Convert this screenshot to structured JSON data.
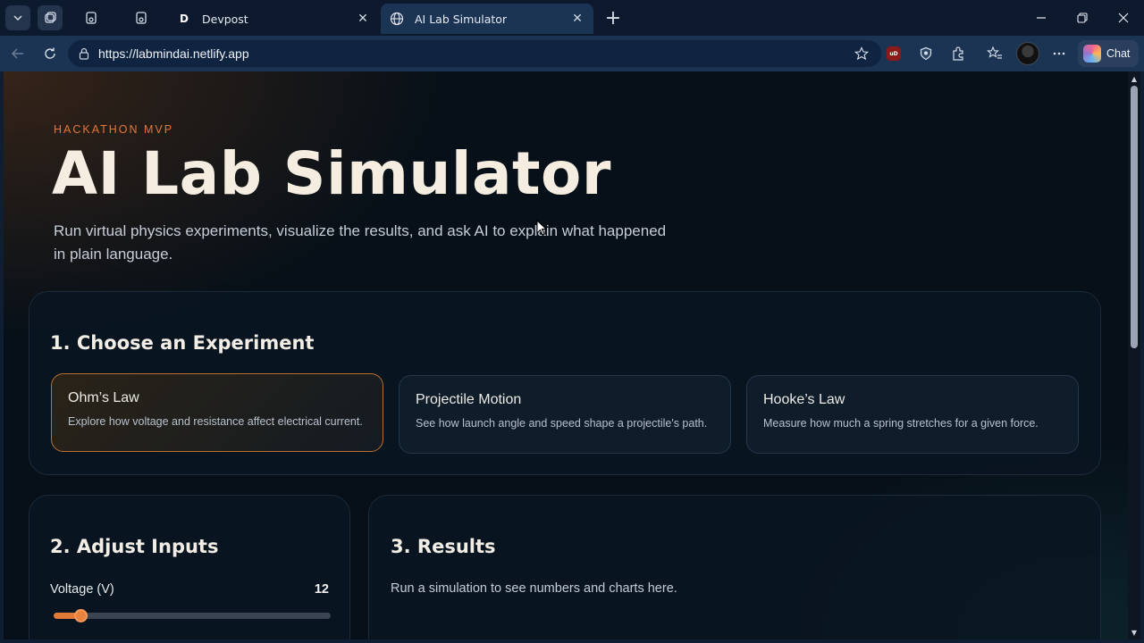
{
  "browser": {
    "tabs": [
      {
        "favicon": "D",
        "title": "Devpost",
        "active": false
      },
      {
        "favicon": "globe-icon",
        "title": "AI Lab Simulator",
        "active": true
      }
    ],
    "url": "https://labmindai.netlify.app",
    "copilot_label": "Chat",
    "ublock_badge": "uD"
  },
  "page": {
    "eyebrow": "HACKATHON MVP",
    "title": "AI Lab Simulator",
    "subtitle": "Run virtual physics experiments, visualize the results, and ask AI to explain what happened in plain language.",
    "choose": {
      "heading": "1. Choose an Experiment",
      "experiments": [
        {
          "name": "Ohm’s Law",
          "description": "Explore how voltage and resistance affect electrical current.",
          "selected": true
        },
        {
          "name": "Projectile Motion",
          "description": "See how launch angle and speed shape a projectile's path.",
          "selected": false
        },
        {
          "name": "Hooke’s Law",
          "description": "Measure how much a spring stretches for a given force.",
          "selected": false
        }
      ]
    },
    "inputs": {
      "heading": "2. Adjust Inputs",
      "voltage_label": "Voltage (V)",
      "voltage_value": "12",
      "voltage_fraction": 0.04
    },
    "results": {
      "heading": "3. Results",
      "hint": "Run a simulation to see numbers and charts here."
    }
  },
  "colors": {
    "accent": "#e07a38",
    "title": "#f4ede0",
    "tab_active": "#1b3454"
  }
}
